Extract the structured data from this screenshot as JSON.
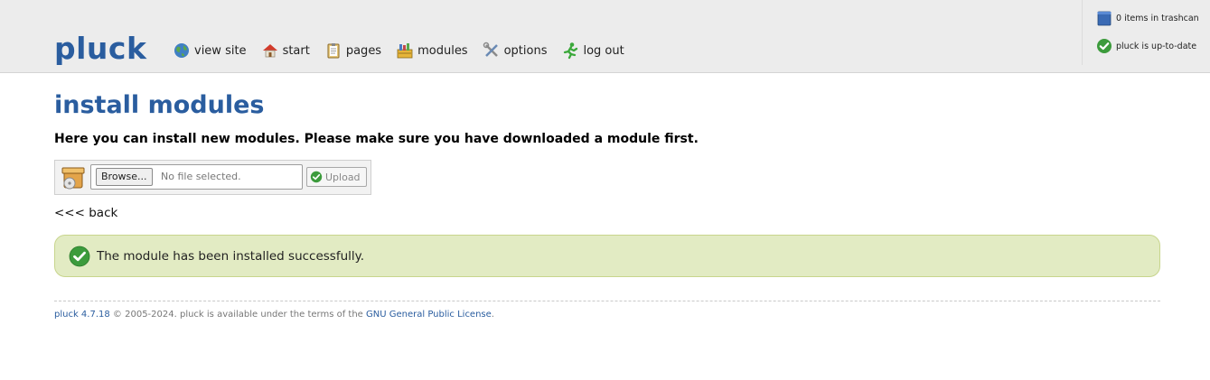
{
  "header": {
    "logo": "pluck",
    "nav": [
      {
        "label": "view site",
        "icon": "globe-icon"
      },
      {
        "label": "start",
        "icon": "home-icon"
      },
      {
        "label": "pages",
        "icon": "pages-icon"
      },
      {
        "label": "modules",
        "icon": "modules-icon"
      },
      {
        "label": "options",
        "icon": "tools-icon"
      },
      {
        "label": "log out",
        "icon": "running-man-icon"
      }
    ],
    "side": {
      "trashcan": "0 items in trashcan",
      "status": "pluck is up-to-date"
    }
  },
  "main": {
    "title": "install modules",
    "intro": "Here you can install new modules. Please make sure you have downloaded a module first.",
    "upload": {
      "browse_label": "Browse...",
      "file_status": "No file selected.",
      "upload_label": "Upload"
    },
    "back_link": "<<< back",
    "success_message": "The module has been installed successfully."
  },
  "footer": {
    "version": "pluck 4.7.18",
    "text": " © 2005-2024. pluck is available under the terms of the ",
    "license": "GNU General Public License",
    "end": "."
  },
  "colors": {
    "brand": "#2a5d9f",
    "header_bg": "#ececec",
    "success_bg": "#e2ebc3",
    "success_border": "#c8d58d",
    "check_green": "#3c9b3c"
  }
}
